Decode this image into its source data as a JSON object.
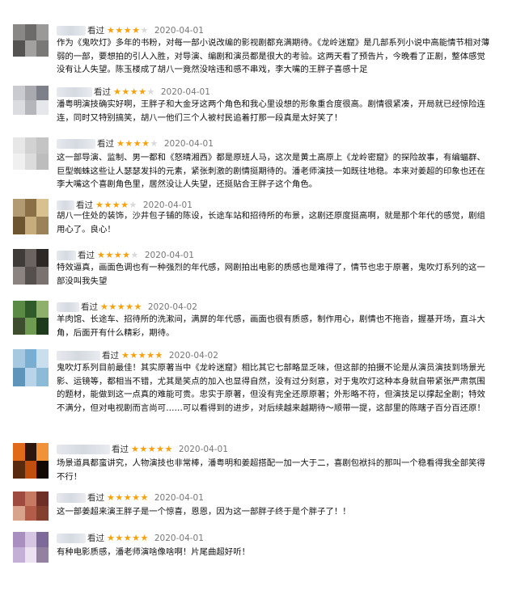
{
  "reviews": [
    {
      "seen": "看过",
      "stars": "★★★★★",
      "rating": 4,
      "date": "2020-04-01",
      "text": "作为《鬼吹灯》多年的书粉，对每一部小说改编的影视剧都充满期待。《龙岭迷窟》是几部系列小说中高能情节相对薄弱的一部，要想拍的引人入胜，对导演、编剧和演员都是很大的考验。这两天看了预告片，今晚看了正剧，整体感觉没有让人失望。陈玉楼成了胡八一竟然没啥违和感不串戏，李大嘴的王胖子喜感十足",
      "avatar": [
        "#8a8886",
        "#6d6b6a",
        "#9b9997",
        "#555352",
        "#a3a19f",
        "#7a7876"
      ]
    },
    {
      "seen": "看过",
      "stars": "★★★★★",
      "rating": 4,
      "date": "2020-04-01",
      "text": "潘粤明演技确实好啊，王胖子和大金牙这两个角色和我心里设想的形象重合度很高。剧情很紧凑，开局就已经惊险连连，同时又特别搞笑，胡八一他们三个人被村民追着打那一段真是太好笑了！",
      "avatar": [
        "#c9cbd0",
        "#a8aab0",
        "#7d8088",
        "#dadcdf",
        "#b4b6bc",
        "#e6e7ea"
      ]
    },
    {
      "seen": "看过",
      "stars": "★★★★★",
      "rating": 4,
      "date": "2020-04-01",
      "text": "这一部导演、监制、男一都和《怒晴湘西》都是原班人马，这次是黄土高原上《龙岭密窟》的探险故事，有编蝠群、巨型蜘蛛这些让人瑟瑟发抖的元素，紧张刺激的剧情挺期待的。潘老师演技一如既往地稳。本来对姜超的印象也还在李大嘴这个喜剧角色里，居然没让人失望，还挺贴合王胖子这个角色。",
      "avatar": [
        "#e7e7e7",
        "#d2d2d2",
        "#c4c4c4",
        "#f0f0f0",
        "#dcdcdc",
        "#bdbdbd"
      ]
    },
    {
      "seen": "看过",
      "stars": "★★★★★",
      "rating": 4,
      "date": "2020-04-01",
      "text": "胡八一住处的装饰，沙井包子铺的陈设，长途车站和招待所的布景，这剧还原度挺高啊，就是那个年代的感觉，剧组用心了。良心！",
      "avatar": [
        "#b29a72",
        "#8a6f47",
        "#d8c08f",
        "#6e5532",
        "#c7ad7c",
        "#9c8258"
      ]
    },
    {
      "seen": "看过",
      "stars": "★★★★★",
      "rating": 4,
      "date": "2020-04-01",
      "text": "特效逼真，画面色调也有一种强烈的年代感，网剧拍出电影的质感也是难得了，情节也忠于原著，鬼吹灯系列的这一部没叫我失望",
      "avatar": [
        "#3f3b39",
        "#6a6360",
        "#2b2826",
        "#8b8380",
        "#55504d",
        "#7a726e"
      ]
    },
    {
      "seen": "看过",
      "stars": "★★★★★",
      "rating": 5,
      "date": "2020-04-02",
      "text": "羊肉馆、长途车、招待所的洗漱间，满屏的年代感，画面也很有质感，制作用心，剧情也不拖沓，握基开场，直斗大角，后面开有什么精彩，期待。",
      "avatar": [
        "#5b8a44",
        "#2f5a2a",
        "#8fb06a",
        "#3d4d2e",
        "#6f9a52",
        "#1e3a1c"
      ]
    },
    {
      "seen": "看过",
      "stars": "★★★★★",
      "rating": 5,
      "date": "2020-04-02",
      "text": "鬼吹灯系列目前最佳！其实原著当中《龙岭迷窟》相比其它七部略显乏味，但这部的拍摄不论是从演员演技到场景光影、运镜等，都相当不错，尤其是笑点的加入也显得自然，没有过分刻意，对于鬼吹灯这种本身就自带紧张严肃氛围的题材，能做到这一点真的难能可贵。忠实于原著，但没有完全还原原著；外形略不符，但演技足以撑起全剧；特效不满分，但对电视剧而言尚可……可以看得到的进步，对后续越来越期待～顺带一提，这部里的陈瞎子百分百还原！",
      "avatar": [
        "#a6c8e0",
        "#7aaed0",
        "#c9dfee",
        "#5f94bb",
        "#b8d4e8",
        "#8cbbd8"
      ]
    },
    {
      "seen": "看过",
      "stars": "★★★★★",
      "rating": 5,
      "date": "2020-04-01",
      "text": "场景道具都蛮讲究，人物演技也非常棒，潘粤明和姜超搭配一加一大于二，喜剧包袱抖的那叫一个稳看得我全部笑得不行！",
      "avatar": [
        "#e06a1a",
        "#2a160c",
        "#f29238",
        "#5a2a10",
        "#c24e0e",
        "#120905"
      ]
    },
    {
      "seen": "看过",
      "stars": "★★★★★",
      "rating": 5,
      "date": "2020-04-01",
      "text": "这一部姜超来演王胖子是一个惊喜，恩恩，因为这一部胖子终于是个胖子了！！",
      "avatar": [
        "#9e4a3e",
        "#c77a62",
        "#6e2f28",
        "#d9a28a",
        "#b35c4a",
        "#84402f"
      ]
    },
    {
      "seen": "看过",
      "stars": "★★★★★",
      "rating": 5,
      "date": "2020-04-01",
      "text": "有种电影质感，潘老师演啥像啥啊！片尾曲超好听！",
      "avatar": [
        "#a88fc0",
        "#d7c6e2",
        "#7e6a99",
        "#c4b0d6",
        "#ece2f2",
        "#94809f"
      ]
    }
  ]
}
